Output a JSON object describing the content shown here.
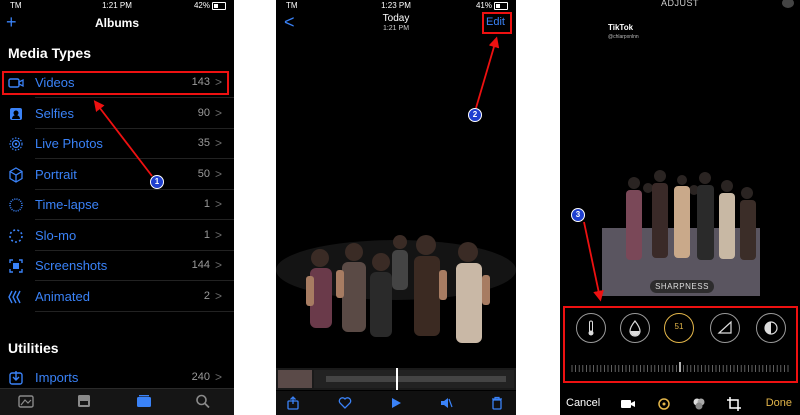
{
  "panel1": {
    "status": {
      "carrier": "TM",
      "time": "1:21 PM",
      "battery": "42%"
    },
    "header": {
      "title": "Albums",
      "add": "+"
    },
    "media_types_heading": "Media Types",
    "items": [
      {
        "label": "Videos",
        "count": "143",
        "icon": "video-icon"
      },
      {
        "label": "Selfies",
        "count": "90",
        "icon": "selfie-icon"
      },
      {
        "label": "Live Photos",
        "count": "35",
        "icon": "live-photo-icon"
      },
      {
        "label": "Portrait",
        "count": "50",
        "icon": "portrait-cube-icon"
      },
      {
        "label": "Time-lapse",
        "count": "1",
        "icon": "timelapse-icon"
      },
      {
        "label": "Slo-mo",
        "count": "1",
        "icon": "slomo-icon"
      },
      {
        "label": "Screenshots",
        "count": "144",
        "icon": "screenshot-icon"
      },
      {
        "label": "Animated",
        "count": "2",
        "icon": "animated-icon"
      }
    ],
    "utilities_heading": "Utilities",
    "utilities": [
      {
        "label": "Imports",
        "count": "240",
        "icon": "import-icon"
      }
    ],
    "tabs": [
      "library-icon",
      "for-you-icon",
      "albums-icon",
      "search-icon"
    ],
    "chevron": ">",
    "step": "1"
  },
  "panel2": {
    "status": {
      "carrier": "TM",
      "time": "1:23 PM",
      "battery": "41%"
    },
    "header": {
      "back": "<",
      "date": "Today",
      "time": "1:21 PM",
      "edit": "Edit"
    },
    "step": "2"
  },
  "panel3": {
    "title": "ADJUST",
    "watermark": {
      "brand": "TikTok",
      "user": "@chlarpxnlnn"
    },
    "tool_label": "SHARPNESS",
    "tool_value": "51",
    "cancel": "Cancel",
    "done": "Done",
    "step": "3"
  },
  "colors": {
    "accent": "#3a82f7",
    "highlight": "#e11111",
    "badge": "#1f3fcf",
    "gold": "#e3b64a"
  }
}
